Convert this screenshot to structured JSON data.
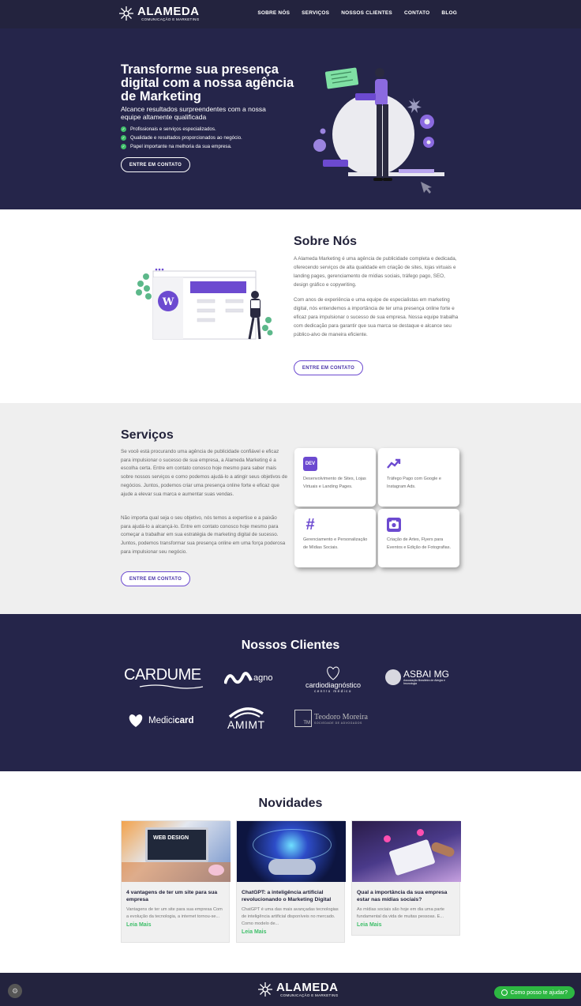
{
  "brand": {
    "name": "ALAMEDA",
    "tagline": "COMUNICAÇÃO E MARKETING"
  },
  "nav": {
    "items": [
      "SOBRE NÓS",
      "SERVIÇOS",
      "NOSSOS CLIENTES",
      "CONTATO",
      "BLOG"
    ]
  },
  "hero": {
    "title": "Transforme sua presença digital com a nossa agência de Marketing",
    "subtitle": "Alcance resultados surpreendentes com a nossa equipe altamente qualificada",
    "checks": [
      "Profissionais e serviços especializados.",
      "Qualidade e resultados proporcionados ao negócio.",
      "Papel importante na melhoria da sua empresa."
    ],
    "cta": "ENTRE EM CONTATO"
  },
  "sobre": {
    "title": "Sobre Nós",
    "p1": "A Alameda Marketing é uma agência de publicidade completa e dedicada, oferecendo serviços de alta qualidade em criação de sites, lojas virtuais e landing pages, gerenciamento de mídias sociais, tráfego pago, SEO, design gráfico e copywriting.",
    "p2": "Com anos de experiência e uma equipe de especialistas em marketing digital, nós entendemos a importância de ter uma presença online forte e eficaz para impulsionar o sucesso de sua empresa. Nossa equipe trabalha com dedicação para garantir que sua marca se destaque e alcance seu público-alvo de maneira eficiente.",
    "cta": "ENTRE EM CONTATO"
  },
  "servicos": {
    "title": "Serviços",
    "p1": "Se você está procurando uma agência de publicidade confiável e eficaz para impulsionar o sucesso de sua empresa, a Alameda Marketing é a escolha certa. Entre em contato conosco hoje mesmo para saber mais sobre nossos serviços e como podemos ajudá-lo a atingir seus objetivos de negócios. Juntos, podemos criar uma presença online forte e eficaz que ajude a elevar sua marca e aumentar suas vendas.",
    "p2": "Não importa qual seja o seu objetivo, nós temos a expertise e a paixão para ajudá-lo a alcançá-lo. Entre em contato conosco hoje mesmo para começar a trabalhar em sua estratégia de marketing digital de sucesso. Juntos, podemos transformar sua presença online em uma força poderosa para impulsionar seu negócio.",
    "cta": "ENTRE EM CONTATO",
    "cards": [
      {
        "icon": "dev-icon",
        "icon_text": "DEV",
        "text": "Desenvolvimento de Sites, Lojas Virtuais e Landing Pages."
      },
      {
        "icon": "trending-up-icon",
        "icon_text": "",
        "text": "Tráfego Pago com Google e Instagram Ads."
      },
      {
        "icon": "hashtag-icon",
        "icon_text": "#",
        "text": "Gerenciamento e Personalização de Mídias Sociais."
      },
      {
        "icon": "camera-icon",
        "icon_text": "",
        "text": "Criação de Artes, Flyers para Eventos e Edição de Fotografias."
      }
    ]
  },
  "clientes": {
    "title": "Nossos Clientes",
    "logos": {
      "cardume": "CARDUME",
      "magno": "agno",
      "cardio": "cardiodiagnóstico",
      "cardio_sub": "centro médico",
      "asbai": "ASBAI MG",
      "asbai_sub": "Associação Brasileira de Alergia e Imunologia",
      "medicicard_a": "Medici",
      "medicicard_b": "card",
      "amimt": "AMIMT",
      "teodoro": "Teodoro Moreira",
      "teodoro_sub": "SOCIEDADE DE ADVOGADOS",
      "teodoro_mark": "TM"
    }
  },
  "novidades": {
    "title": "Novidades",
    "posts": [
      {
        "title": "4 vantagens de ter um site para sua empresa",
        "excerpt": "Vantagens de ter um site para sua empresa Com a evolução da tecnologia, a internet tornou-se...",
        "more": "Leia Mais",
        "img_text": "WEB DESIGN"
      },
      {
        "title": "ChatGPT: a inteligência artificial revolucionando o Marketing Digital",
        "excerpt": "ChatGPT é uma das mais avançadas tecnologias de inteligência artificial disponíveis no mercado. Como modelo de...",
        "more": "Leia Mais"
      },
      {
        "title": "Qual a importância da sua empresa estar nas mídias sociais?",
        "excerpt": "As mídias sociais são hoje em dia uma parte fundamental da vida de muitas pessoas. E...",
        "more": "Leia Mais"
      }
    ]
  },
  "footer": {
    "whatsapp": "Como posso te ajudar?"
  },
  "colors": {
    "navy": "#25254a",
    "purple": "#6c4ad0",
    "green": "#3fbf6a"
  }
}
